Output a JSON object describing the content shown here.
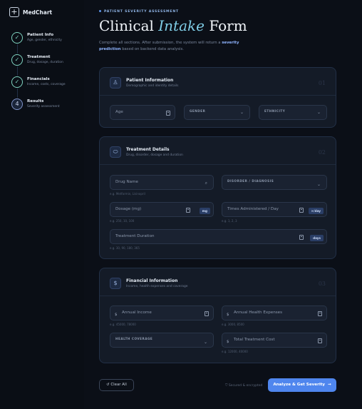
{
  "brand": {
    "icon": "plus-icon",
    "name": "MedChart"
  },
  "steps": [
    {
      "title": "Patient Info",
      "sub": "Age, gender, ethnicity",
      "state": "done",
      "glyph": "✓"
    },
    {
      "title": "Treatment",
      "sub": "Drug, dosage, duration",
      "state": "done",
      "glyph": "✓"
    },
    {
      "title": "Financials",
      "sub": "Income, costs, coverage",
      "state": "done",
      "glyph": "✓"
    },
    {
      "title": "Results",
      "sub": "Severity assessment",
      "state": "current",
      "glyph": "4"
    }
  ],
  "header": {
    "eyebrow": "PATIENT SEVERITY ASSESSMENT",
    "title_a": "Clinical ",
    "title_b": "Intake",
    "title_c": " Form",
    "intro_a": "Complete all sections. After submission, the system will return a ",
    "intro_b": "severity prediction",
    "intro_c": " based on backend data analysis."
  },
  "patient": {
    "title": "Patient Information",
    "sub": "Demographic and identity details",
    "num": "01",
    "age": "Age",
    "gender": "GENDER",
    "ethnicity": "ETHNICITY"
  },
  "treatment": {
    "title": "Treatment Details",
    "sub": "Drug, disorder, dosage and duration",
    "num": "02",
    "drug": "Drug Name",
    "drug_hint": "e.g. Metformin, Lisinopril",
    "disorder": "DISORDER / DIAGNOSIS",
    "dosage": "Dosage (mg)",
    "dosage_unit": "mg",
    "dosage_hint": "e.g. 250, 10, 100",
    "times": "Times Administered / Day",
    "times_unit": "×/day",
    "times_hint": "e.g. 1, 2, 3",
    "duration": "Treatment Duration",
    "duration_unit": "days",
    "duration_hint": "e.g. 30, 90, 180, 365"
  },
  "financial": {
    "title": "Financial Information",
    "sub": "Income, health expenses and coverage",
    "num": "03",
    "currency": "$",
    "income": "Annual Income",
    "income_hint": "e.g. 45000, 78000",
    "expenses": "Annual Health Expenses",
    "expenses_hint": "e.g. 3000, 8500",
    "coverage": "HEALTH COVERAGE",
    "total": "Total Treatment Cost",
    "total_hint": "e.g. 12000, 40000"
  },
  "footer": {
    "clear": "Clear All",
    "secure": "Secured & encrypted",
    "submit": "Analyze & Get Severity"
  }
}
